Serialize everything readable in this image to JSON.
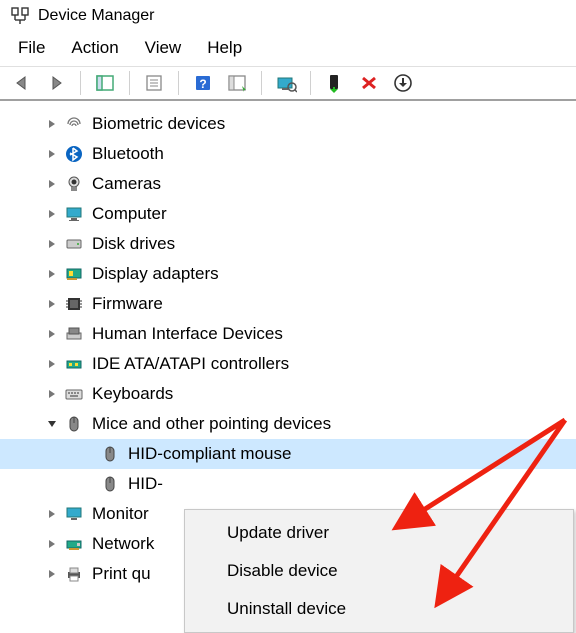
{
  "window": {
    "title": "Device Manager"
  },
  "menubar": {
    "file": "File",
    "action": "Action",
    "view": "View",
    "help": "Help"
  },
  "tree": {
    "items": [
      {
        "label": "Biometric devices",
        "icon": "fingerprint",
        "state": "collapsed",
        "depth": 1
      },
      {
        "label": "Bluetooth",
        "icon": "bluetooth",
        "state": "collapsed",
        "depth": 1
      },
      {
        "label": "Cameras",
        "icon": "camera",
        "state": "collapsed",
        "depth": 1
      },
      {
        "label": "Computer",
        "icon": "computer",
        "state": "collapsed",
        "depth": 1
      },
      {
        "label": "Disk drives",
        "icon": "disk",
        "state": "collapsed",
        "depth": 1
      },
      {
        "label": "Display adapters",
        "icon": "display-adapter",
        "state": "collapsed",
        "depth": 1
      },
      {
        "label": "Firmware",
        "icon": "firmware",
        "state": "collapsed",
        "depth": 1
      },
      {
        "label": "Human Interface Devices",
        "icon": "hid",
        "state": "collapsed",
        "depth": 1
      },
      {
        "label": "IDE ATA/ATAPI controllers",
        "icon": "ide",
        "state": "collapsed",
        "depth": 1
      },
      {
        "label": "Keyboards",
        "icon": "keyboard",
        "state": "collapsed",
        "depth": 1
      },
      {
        "label": "Mice and other pointing devices",
        "icon": "mouse",
        "state": "expanded",
        "depth": 1
      },
      {
        "label": "HID-compliant mouse",
        "icon": "mouse",
        "state": "none",
        "depth": 2,
        "selected": true
      },
      {
        "label": "HID-",
        "icon": "mouse",
        "state": "none",
        "depth": 2
      },
      {
        "label": "Monitor",
        "icon": "monitor",
        "state": "collapsed",
        "depth": 1
      },
      {
        "label": "Network",
        "icon": "network",
        "state": "collapsed",
        "depth": 1
      },
      {
        "label": "Print qu",
        "icon": "printer",
        "state": "collapsed",
        "depth": 1
      }
    ]
  },
  "context_menu": {
    "items": [
      {
        "label": "Update driver"
      },
      {
        "label": "Disable device"
      },
      {
        "label": "Uninstall device"
      }
    ]
  },
  "icons": {
    "fingerprint": "fingerprint-icon",
    "bluetooth": "bluetooth-icon",
    "camera": "camera-icon",
    "computer": "computer-icon",
    "disk": "disk-icon",
    "display-adapter": "display-adapter-icon",
    "firmware": "firmware-icon",
    "hid": "hid-icon",
    "ide": "ide-icon",
    "keyboard": "keyboard-icon",
    "mouse": "mouse-icon",
    "monitor": "monitor-icon",
    "network": "network-icon",
    "printer": "printer-icon"
  }
}
